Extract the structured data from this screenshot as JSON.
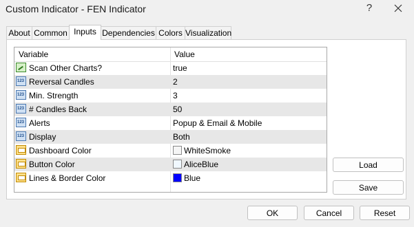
{
  "window": {
    "title": "Custom Indicator - FEN Indicator",
    "help_label": "?",
    "close_label": "✕"
  },
  "tabs": [
    {
      "label": "About"
    },
    {
      "label": "Common"
    },
    {
      "label": "Inputs",
      "active": true
    },
    {
      "label": "Dependencies"
    },
    {
      "label": "Colors"
    },
    {
      "label": "Visualization"
    }
  ],
  "grid": {
    "col_variable": "Variable",
    "col_value": "Value",
    "rows": [
      {
        "icon": "bool-input-icon",
        "variable": "Scan Other Charts?",
        "value": "true"
      },
      {
        "icon": "number-input-icon",
        "variable": "Reversal Candles",
        "value": "2"
      },
      {
        "icon": "number-input-icon",
        "variable": "Min. Strength",
        "value": "3"
      },
      {
        "icon": "number-input-icon",
        "variable": "# Candles Back",
        "value": "50"
      },
      {
        "icon": "number-input-icon",
        "variable": "Alerts",
        "value": "Popup & Email & Mobile"
      },
      {
        "icon": "number-input-icon",
        "variable": "Display",
        "value": "Both"
      },
      {
        "icon": "color-input-icon",
        "variable": "Dashboard Color",
        "value": "WhiteSmoke",
        "swatch": "#f5f5f5"
      },
      {
        "icon": "color-input-icon",
        "variable": "Button Color",
        "value": "AliceBlue",
        "swatch": "#f0f8ff"
      },
      {
        "icon": "color-input-icon",
        "variable": "Lines & Border Color",
        "value": "Blue",
        "swatch": "#0000ff"
      }
    ]
  },
  "number_icon_text": "123",
  "side_buttons": {
    "load_label": "Load",
    "save_label": "Save"
  },
  "footer_buttons": {
    "ok_label": "OK",
    "cancel_label": "Cancel",
    "reset_label": "Reset"
  }
}
